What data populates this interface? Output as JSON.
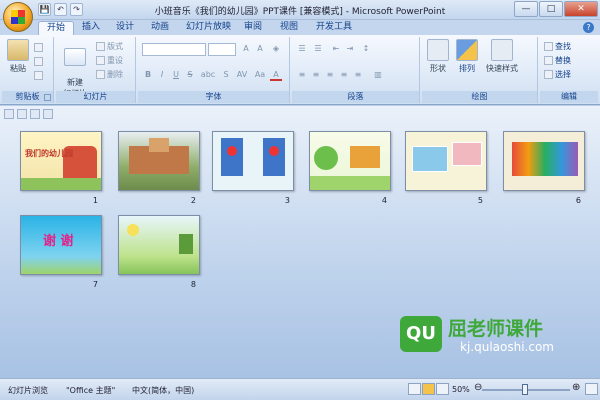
{
  "window": {
    "title": "小班音乐《我们的幼儿园》PPT课件 [兼容模式] - Microsoft PowerPoint",
    "controls": [
      "—",
      "□",
      "✕"
    ]
  },
  "qat": [
    "💾",
    "↶",
    "↷"
  ],
  "tabs": [
    "开始",
    "插入",
    "设计",
    "动画",
    "幻灯片放映",
    "审阅",
    "视图",
    "开发工具"
  ],
  "ribbon": {
    "clipboard": {
      "label": "剪贴板",
      "paste": "粘贴"
    },
    "slides": {
      "label": "幻灯片",
      "new_slide": "新建\n幻灯片",
      "layout": "版式",
      "reset": "重设",
      "delete": "删除"
    },
    "font": {
      "label": "字体",
      "buttons": [
        "B",
        "I",
        "U",
        "S",
        "abc",
        "S",
        "AV",
        "Aa",
        "A"
      ]
    },
    "paragraph": {
      "label": "段落"
    },
    "drawing": {
      "label": "绘图",
      "shape": "形状",
      "arrange": "排列",
      "quick_style": "快速样式"
    },
    "editing": {
      "label": "编辑",
      "find": "查找",
      "replace": "替换",
      "select": "选择"
    }
  },
  "slides": [
    {
      "num": "1",
      "title": "我们的幼儿园",
      "bg": "#f3e3a8"
    },
    {
      "num": "2",
      "bg": "#8fae6a"
    },
    {
      "num": "3",
      "bg": "#e8f4f8"
    },
    {
      "num": "4",
      "bg": "#eaf6d8"
    },
    {
      "num": "5",
      "bg": "#f6f3d8"
    },
    {
      "num": "6",
      "bg": "#f4eed8"
    },
    {
      "num": "7",
      "title": "谢 谢",
      "bg": "#2ab3e6"
    },
    {
      "num": "8",
      "bg": "#bde28a"
    }
  ],
  "watermark": {
    "brand": "屈老师课件",
    "url": "kj.qulaoshi.com",
    "logo": "QU"
  },
  "statusbar": {
    "view": "幻灯片浏览",
    "theme": "\"Office 主题\"",
    "language": "中文(简体，中国)",
    "zoom": "50%",
    "zoom_level": 0.5
  }
}
